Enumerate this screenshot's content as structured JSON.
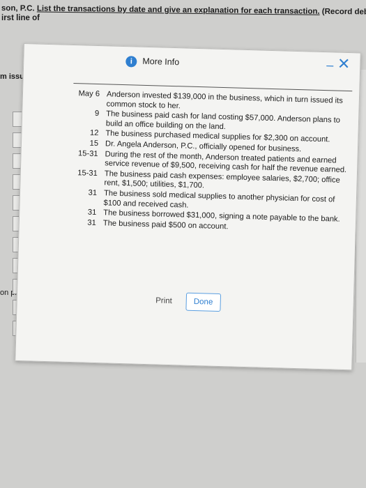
{
  "background": {
    "line1_prefix": "son, P.C. ",
    "line1_underlined": "List the transactions by date and give an explanation for each transaction.",
    "line1_suffix": " (Record debits first, then credits. Selec",
    "line2": "irst line of",
    "issued": "m issued i",
    "plans": "on plans t",
    "d_label_top": "D",
    "d_label_bottom": "D"
  },
  "dialog": {
    "icon": "info-icon",
    "title": "More Info",
    "minimize_label": "–",
    "close_label": "✕",
    "transactions": [
      {
        "date": "May 6",
        "text": "Anderson invested $139,000 in the business, which in turn issued its common stock to her."
      },
      {
        "date": "9",
        "text": "The business paid cash for land costing $57,000. Anderson plans to build an office building on the land."
      },
      {
        "date": "12",
        "text": "The business purchased medical supplies for $2,300 on account."
      },
      {
        "date": "15",
        "text": "Dr. Angela Anderson, P.C., officially opened for business."
      },
      {
        "date": "15-31",
        "text": "During the rest of the month, Anderson treated patients and earned service revenue of $9,500, receiving cash for half the revenue earned."
      },
      {
        "date": "15-31",
        "text": "The business paid cash expenses: employee salaries, $2,700; office rent, $1,500; utilities, $1,700."
      },
      {
        "date": "31",
        "text": "The business sold medical supplies to another physician for cost of $100 and received cash."
      },
      {
        "date": "31",
        "text": "The business borrowed $31,000, signing a note payable to the bank."
      },
      {
        "date": "31",
        "text": "The business paid $500 on account."
      }
    ],
    "print_label": "Print",
    "done_label": "Done"
  }
}
